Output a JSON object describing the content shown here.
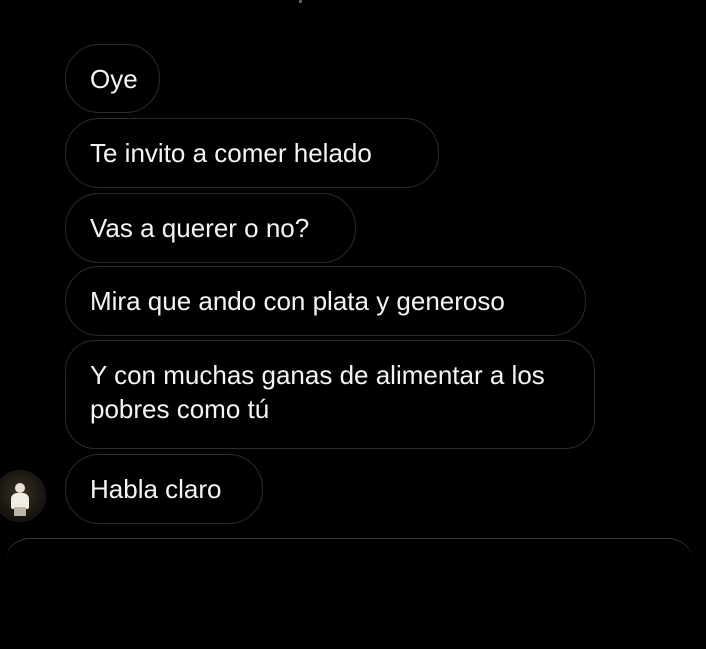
{
  "messages": [
    {
      "text": "Oye"
    },
    {
      "text": "Te invito a comer helado"
    },
    {
      "text": "Vas a querer o no?"
    },
    {
      "text": "Mira que ando con plata y generoso"
    },
    {
      "text": "Y con muchas ganas de alimentar a los pobres como tú"
    },
    {
      "text": "Habla claro"
    }
  ],
  "colors": {
    "background": "#000000",
    "bubble_border": "#2c2c2c",
    "text": "#f4f4f4"
  }
}
